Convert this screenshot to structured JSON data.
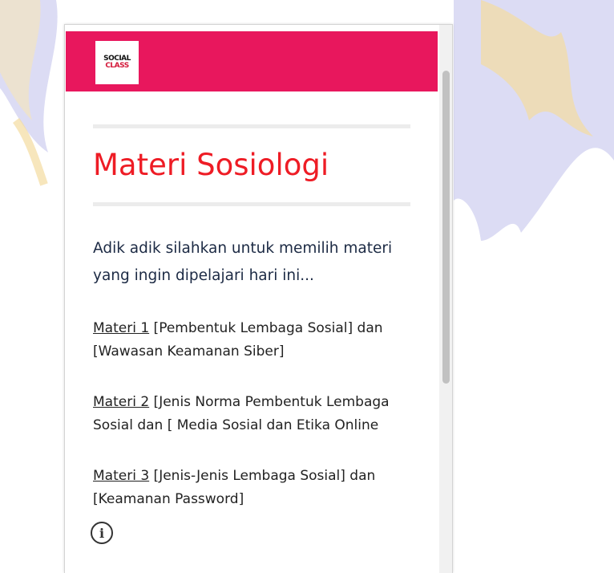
{
  "logo": {
    "line1": "SOCIAL",
    "line2": "CLASS"
  },
  "page": {
    "title": "Materi Sosiologi",
    "intro": "Adik adik silahkan untuk memilih materi yang ingin dipelajari hari ini..."
  },
  "materials": [
    {
      "link": " Materi 1",
      "desc": "  [Pembentuk Lembaga Sosial] dan [Wawasan Keamanan Siber]"
    },
    {
      "link": " Materi 2",
      "desc": "  [Jenis Norma Pembentuk Lembaga Sosial dan [ Media Sosial dan Etika Online"
    },
    {
      "link": " Materi 3",
      "desc": "  [Jenis-Jenis Lembaga Sosial] dan [Keamanan Password]"
    }
  ],
  "info_icon": {
    "glyph": "i"
  },
  "colors": {
    "header": "#e8175d",
    "title": "#ee1c25",
    "ornament": "#dcdcf4",
    "ornament_gold": "#f3dca0"
  }
}
